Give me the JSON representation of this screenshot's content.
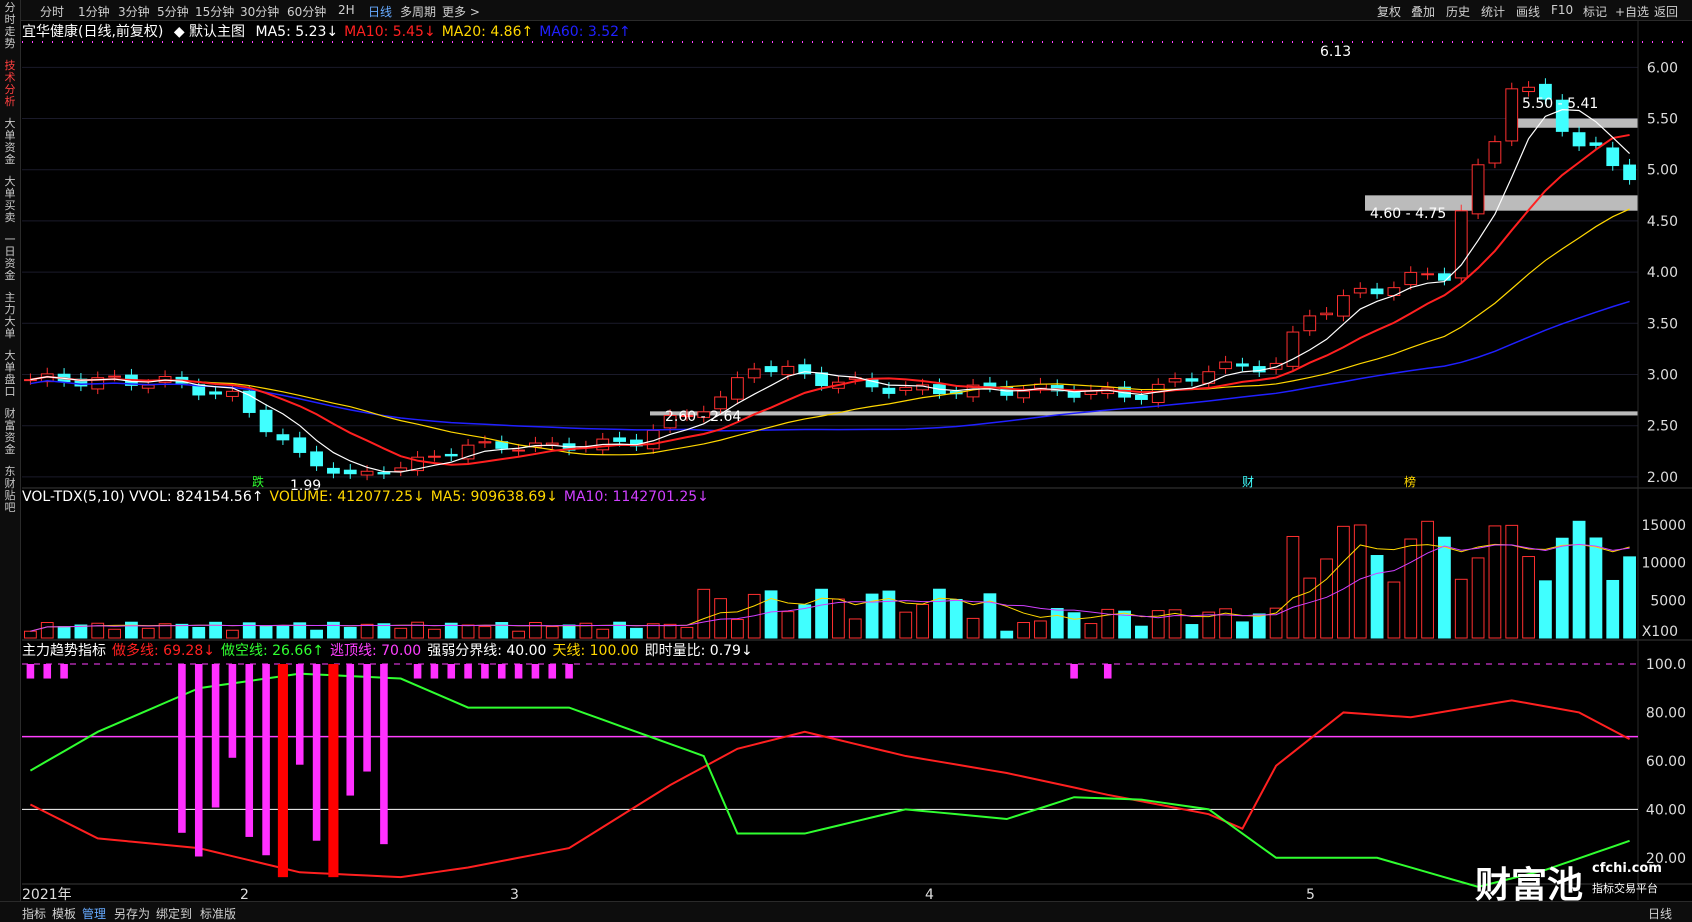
{
  "toolbar": {
    "left": [
      "分时",
      "1分钟",
      "3分钟",
      "5分钟",
      "15分钟",
      "30分钟",
      "60分钟",
      "2H",
      "日线",
      "多周期",
      "更多 >"
    ],
    "right": [
      "复权",
      "叠加",
      "历史",
      "统计",
      "画线",
      "F10",
      "标记",
      "+自选",
      "返回"
    ],
    "active": "日线"
  },
  "sidebar": [
    "分时走势",
    "技术分析",
    "大单资金",
    "大单买卖",
    "一日资金",
    "主力大单",
    "大单盘口",
    "财富资金",
    "东财贴吧"
  ],
  "sidebar_active": "技术分析",
  "main_legend": {
    "title": "宜华健康(日线,前复权)",
    "chart": "◆ 默认主图",
    "items": [
      {
        "text": "MA5: 5.23↓",
        "color": "#ffffff"
      },
      {
        "text": "MA10: 5.45↓",
        "color": "#ff2020"
      },
      {
        "text": "MA20: 4.86↑",
        "color": "#ffd700"
      },
      {
        "text": "MA60: 3.52↑",
        "color": "#2020ff"
      }
    ]
  },
  "vol_legend": [
    {
      "text": "VOL-TDX(5,10) VVOL: 824154.56↑",
      "color": "#ffffff"
    },
    {
      "text": "VOLUME: 412077.25↓",
      "color": "#ffd700"
    },
    {
      "text": "MA5: 909638.69↓",
      "color": "#ffd700"
    },
    {
      "text": "MA10: 1142701.25↓",
      "color": "#d040ff"
    }
  ],
  "ind_legend": [
    {
      "text": "主力趋势指标",
      "color": "#ffffff"
    },
    {
      "text": "做多线: 69.28↓",
      "color": "#ff2020"
    },
    {
      "text": "做空线: 26.66↑",
      "color": "#30ff30"
    },
    {
      "text": "逃顶线: 70.00",
      "color": "#ff40ff"
    },
    {
      "text": "强弱分界线: 40.00",
      "color": "#ffffff"
    },
    {
      "text": "天线: 100.00",
      "color": "#ffd700"
    },
    {
      "text": "即时量比: 0.79↓",
      "color": "#ffffff"
    }
  ],
  "price_axis": [
    "6.00",
    "5.50",
    "5.00",
    "4.50",
    "4.00",
    "3.50",
    "3.00",
    "2.50",
    "2.00"
  ],
  "vol_axis": [
    "15000",
    "10000",
    "5000",
    "X100"
  ],
  "ind_axis": [
    "100.0",
    "80.00",
    "60.00",
    "40.00",
    "20.00"
  ],
  "date_axis": [
    "2021年",
    "2",
    "3",
    "4",
    "5"
  ],
  "annotations": {
    "high": "6.13",
    "low": "1.99",
    "zone1": "5.50 - 5.41",
    "zone2": "4.60 - 4.75",
    "zone3": "2.60 - 2.64",
    "mark_die": "跌",
    "mark_cai": "财",
    "mark_bang": "榜"
  },
  "bottom_tabs": [
    "指标",
    "模板",
    "管理",
    "另存为",
    "绑定到",
    "标准版"
  ],
  "bottom_active": "管理",
  "period_label": "日线",
  "watermark": {
    "brand": "财富池",
    "site": "cfchi.com",
    "slogan": "指标交易平台"
  },
  "colors": {
    "up": "#ff3030",
    "down": "#40ffff",
    "bg": "#000000"
  }
}
